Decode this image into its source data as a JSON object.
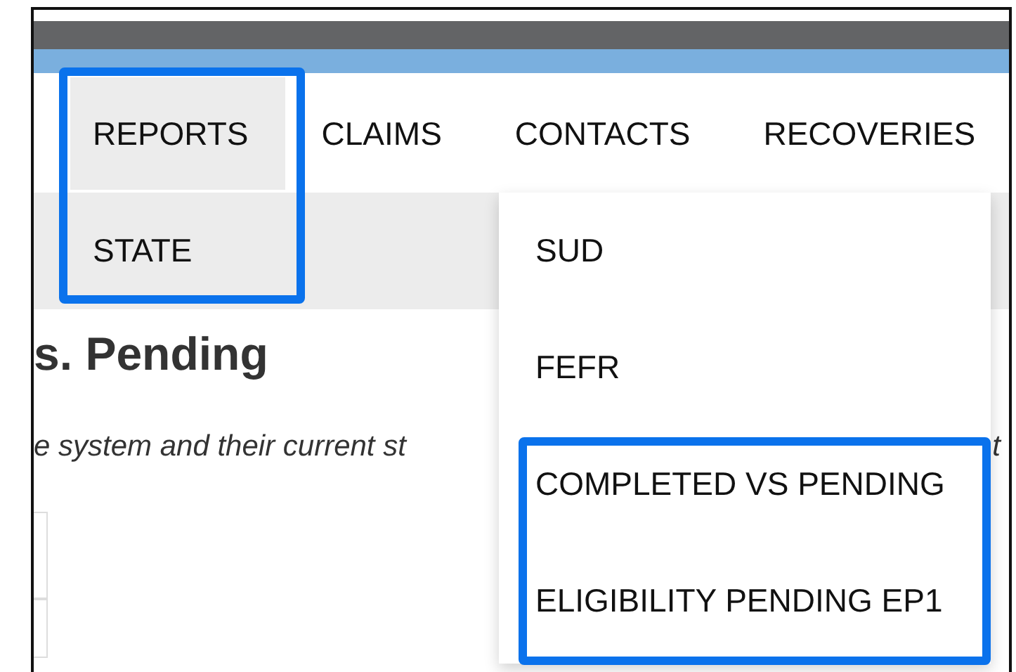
{
  "nav": {
    "items": [
      {
        "label": "REPORTS",
        "selected": true,
        "annotated": true
      },
      {
        "label": "CLAIMS",
        "selected": false,
        "annotated": false
      },
      {
        "label": "CONTACTS",
        "selected": false,
        "annotated": false
      },
      {
        "label": "RECOVERIES",
        "selected": false,
        "annotated": false
      }
    ]
  },
  "subnav": {
    "items": [
      {
        "label": "STATE"
      }
    ]
  },
  "dropdown": {
    "items": [
      {
        "label": "SUD",
        "annotated": false
      },
      {
        "label": "FEFR",
        "annotated": false
      },
      {
        "label": "COMPLETED VS PENDING",
        "annotated": true
      },
      {
        "label": "ELIGIBILITY PENDING EP1",
        "annotated": true
      }
    ]
  },
  "page": {
    "heading": "s. Pending",
    "description": "e system and their current st",
    "description_tail": "t"
  }
}
